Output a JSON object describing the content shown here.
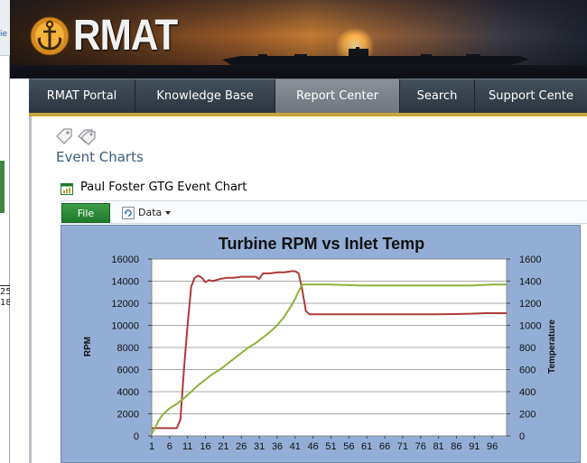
{
  "left_sliver": {
    "text_top": "ie",
    "num1": "25",
    "num2": "18"
  },
  "logo": {
    "text": "RMAT",
    "icon": "anchor-icon"
  },
  "nav": {
    "items": [
      {
        "label": "RMAT Portal",
        "active": false
      },
      {
        "label": "Knowledge Base",
        "active": false
      },
      {
        "label": "Report Center",
        "active": true
      },
      {
        "label": "Search",
        "active": false
      },
      {
        "label": "Support Cente",
        "active": false
      }
    ]
  },
  "page": {
    "section_title": "Event Charts",
    "icons": [
      "tag-icon",
      "tags-icon"
    ]
  },
  "webpart": {
    "icon": "excel-chart-icon",
    "title": "Paul Foster GTG Event Chart"
  },
  "toolbar": {
    "file_label": "File",
    "data_label": "Data"
  },
  "colors": {
    "rpm": "#b03a3a",
    "temp": "#8cb23a",
    "plot_bg": "#ffffff",
    "chart_bg": "#93aed6",
    "nav_accent": "#c8a43a"
  },
  "chart_data": {
    "type": "line",
    "title": "Turbine RPM vs Inlet Temp",
    "ylabel": "RPM",
    "y2label": "Temperature",
    "ylim": [
      0,
      16000
    ],
    "y2lim": [
      0,
      1600
    ],
    "y_ticks": [
      0,
      2000,
      4000,
      6000,
      8000,
      10000,
      12000,
      14000,
      16000
    ],
    "y2_ticks": [
      0,
      200,
      400,
      600,
      800,
      1000,
      1200,
      1400,
      1600
    ],
    "x_tick_labels": [
      "1",
      "6",
      "11",
      "16",
      "21",
      "26",
      "31",
      "36",
      "41",
      "46",
      "51",
      "56",
      "61",
      "66",
      "71",
      "76",
      "81",
      "86",
      "91",
      "96"
    ],
    "xlim": [
      1,
      100
    ],
    "grid": true,
    "series": [
      {
        "axis": "left",
        "x": [
          1,
          2,
          3,
          4,
          5,
          6,
          7,
          8,
          9,
          10,
          11,
          12,
          13,
          14,
          15,
          16,
          17,
          18,
          19,
          20,
          22,
          24,
          26,
          28,
          30,
          31,
          32,
          33,
          34,
          36,
          38,
          40,
          41,
          42,
          43,
          44,
          45,
          46,
          50,
          60,
          70,
          80,
          90,
          94,
          96,
          98,
          100
        ],
        "values": [
          700,
          700,
          700,
          700,
          700,
          700,
          700,
          700,
          1500,
          6000,
          10000,
          13500,
          14300,
          14500,
          14300,
          13900,
          14100,
          14000,
          14100,
          14200,
          14300,
          14300,
          14400,
          14400,
          14400,
          14200,
          14700,
          14700,
          14700,
          14800,
          14800,
          14900,
          14900,
          14700,
          13200,
          11300,
          11000,
          11000,
          11000,
          11000,
          11000,
          11000,
          11050,
          11100,
          11100,
          11100,
          11100
        ]
      },
      {
        "axis": "right",
        "x": [
          1,
          2,
          3,
          4,
          6,
          8,
          10,
          12,
          14,
          16,
          18,
          20,
          22,
          24,
          26,
          28,
          30,
          32,
          34,
          36,
          38,
          39,
          40,
          41,
          42,
          43,
          44,
          46,
          50,
          60,
          70,
          80,
          90,
          96,
          100
        ],
        "values": [
          20,
          80,
          140,
          190,
          250,
          290,
          340,
          400,
          460,
          510,
          560,
          600,
          650,
          700,
          750,
          800,
          840,
          890,
          940,
          1000,
          1080,
          1130,
          1180,
          1240,
          1310,
          1370,
          1370,
          1370,
          1370,
          1360,
          1360,
          1360,
          1360,
          1370,
          1370
        ]
      }
    ]
  }
}
